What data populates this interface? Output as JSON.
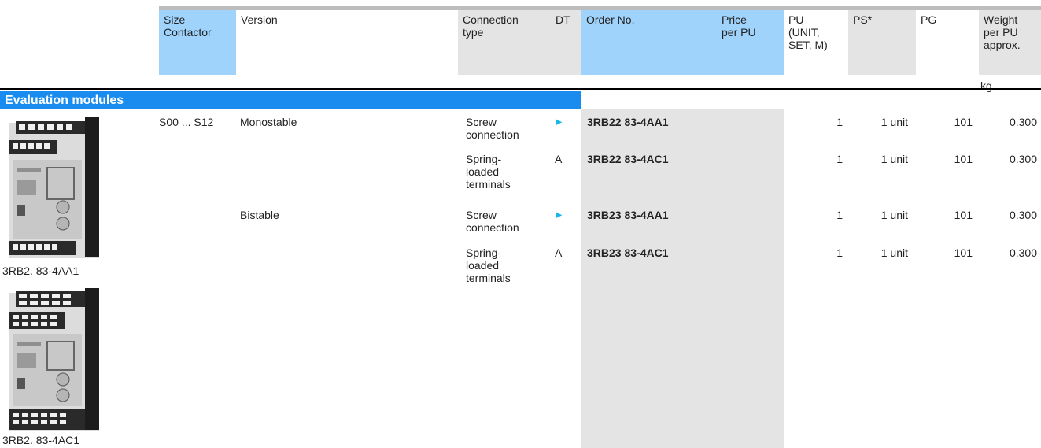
{
  "header": {
    "size_contactor": "Size\nContactor",
    "version": "Version",
    "connection_type": "Connection\ntype",
    "dt": "DT",
    "order_no": "Order No.",
    "price_per_pu": "Price\nper PU",
    "pu": "PU\n(UNIT,\nSET, M)",
    "ps": "PS*",
    "pg": "PG",
    "weight": "Weight\nper PU\napprox.",
    "weight_unit": "kg"
  },
  "section_title": "Evaluation modules",
  "rows": [
    {
      "size": "S00 ... S12",
      "version": "Monostable",
      "connection": "Screw\nconnection",
      "dt": "►",
      "order_no": "3RB22 83-4AA1",
      "pu": "1",
      "ps": "1 unit",
      "pg": "101",
      "weight": "0.300"
    },
    {
      "size": "",
      "version": "",
      "connection": "Spring-\nloaded\nterminals",
      "dt": "A",
      "order_no": "3RB22 83-4AC1",
      "pu": "1",
      "ps": "1 unit",
      "pg": "101",
      "weight": "0.300"
    },
    {
      "size": "",
      "version": "Bistable",
      "connection": "Screw\nconnection",
      "dt": "►",
      "order_no": "3RB23 83-4AA1",
      "pu": "1",
      "ps": "1 unit",
      "pg": "101",
      "weight": "0.300"
    },
    {
      "size": "",
      "version": "",
      "connection": "Spring-\nloaded\nterminals",
      "dt": "A",
      "order_no": "3RB23 83-4AC1",
      "pu": "1",
      "ps": "1 unit",
      "pg": "101",
      "weight": "0.300"
    }
  ],
  "images": [
    {
      "caption": "3RB2. 83-4AA1"
    },
    {
      "caption": "3RB2. 83-4AC1"
    }
  ],
  "colors": {
    "header_blue": "#9fd3fb",
    "header_grey": "#e4e4e4",
    "section_blue": "#1a8cf0",
    "arrow": "#19b6ea"
  }
}
